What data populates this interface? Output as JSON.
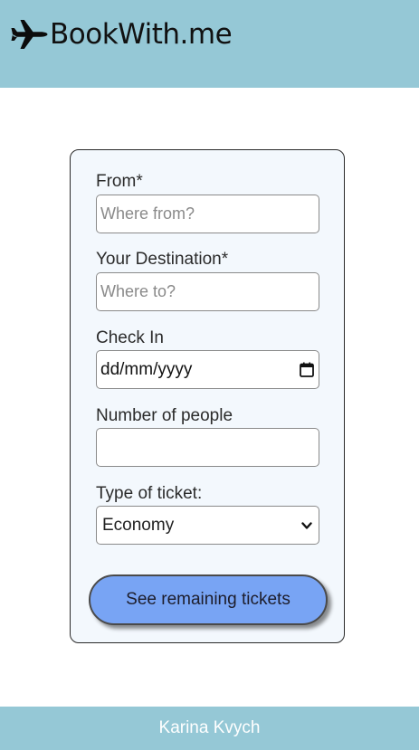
{
  "header": {
    "logo_icon": "airplane-icon",
    "logo_text": "BookWith.me"
  },
  "form": {
    "from": {
      "label": "From*",
      "placeholder": "Where from?"
    },
    "destination": {
      "label": "Your Destination*",
      "placeholder": "Where to?"
    },
    "check_in": {
      "label": "Check In",
      "value": "dd/mm/yyyy",
      "icon": "calendar-icon"
    },
    "people": {
      "label": "Number of people",
      "value": ""
    },
    "ticket_type": {
      "label": "Type of ticket:",
      "selected": "Economy",
      "icon": "chevron-down-icon"
    },
    "submit_label": "See remaining tickets"
  },
  "footer": {
    "text": "Karina Kvych"
  },
  "colors": {
    "header_bg": "#95c8d6",
    "card_bg": "#f3f8fd",
    "button_bg": "#78a4f4",
    "footer_text": "#ffffff"
  }
}
